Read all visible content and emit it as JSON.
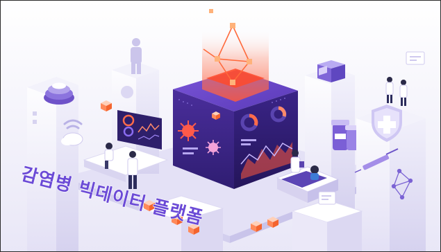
{
  "banner": {
    "title": "감염병 빅데이터 플랫폼"
  },
  "colors": {
    "background": "#ffffff",
    "panel_light": "#eceaf8",
    "panel_mid": "#d9d6f1",
    "cube_top": "#6b45c8",
    "cube_left": "#3d2684",
    "cube_right": "#2b1966",
    "accent_red": "#ef4a4a",
    "accent_orange": "#f89a5a",
    "title_fill": "#6b4ad6",
    "title_stroke": "#ffffff"
  },
  "icons": [
    "wifi-icon",
    "cloud-icon",
    "virus-icon",
    "shield-cross-icon",
    "syringe-icon",
    "pill-bottle-icon",
    "network-node-icon",
    "hologram-person-icon"
  ]
}
